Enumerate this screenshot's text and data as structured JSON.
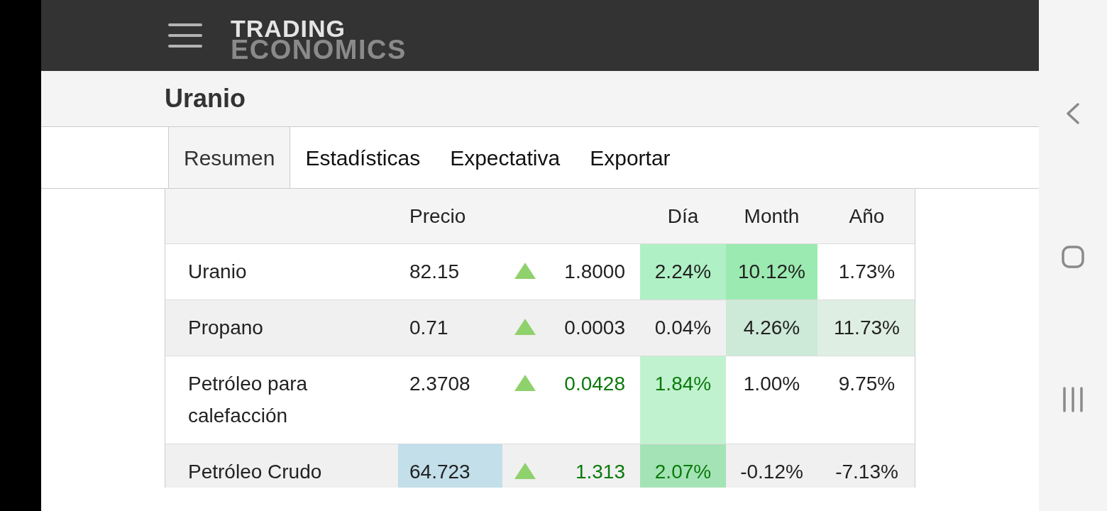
{
  "header": {
    "logo": {
      "line_1": "TRADING",
      "line_2": "ECONOMICS"
    }
  },
  "title": "Uranio",
  "tabs": [
    {
      "label": "Resumen",
      "selected": true
    },
    {
      "label": "Estadísticas",
      "selected": false
    },
    {
      "label": "Expectativa",
      "selected": false
    },
    {
      "label": "Exportar",
      "selected": false
    }
  ],
  "table": {
    "header": {
      "price": "Precio",
      "day": "Día",
      "month": "Month",
      "year": "Año"
    },
    "rows": [
      {
        "column_1": "Uranio",
        "price": {
          "text": "82.15"
        },
        "column_3": {
          "kind": "up"
        },
        "column_4": {
          "text": "1.8000"
        },
        "day": {
          "text": "2.24%",
          "color": "#b0f0c5"
        },
        "month": {
          "text": "10.12%",
          "color": "#9beab1"
        },
        "year": {
          "text": "1.73%"
        }
      },
      {
        "column_1": "Propano",
        "price": {
          "text": "0.71"
        },
        "column_3": {
          "kind": "up"
        },
        "column_4": {
          "text": "0.0003"
        },
        "day": {
          "text": "0.04%"
        },
        "month": {
          "text": "4.26%",
          "color": "#cde9d7"
        },
        "year": {
          "text": "11.73%",
          "color": "#dfeee3"
        }
      },
      {
        "column_1": "Petróleo para calefacción",
        "price": {
          "text": "2.3708"
        },
        "column_3": {
          "kind": "up"
        },
        "column_4": {
          "text": "0.0428",
          "kind": "gain"
        },
        "day": {
          "text": "1.84%",
          "color": "#c1f2d0",
          "kind": "gain"
        },
        "month": {
          "text": "1.00%"
        },
        "year": {
          "text": "9.75%"
        }
      },
      {
        "column_1": "Petróleo Crudo",
        "price": {
          "text": "64.723",
          "color": "#c2dfea"
        },
        "column_3": {
          "kind": "up"
        },
        "column_4": {
          "text": "1.313",
          "kind": "gain"
        },
        "day": {
          "text": "2.07%",
          "color": "#a4e3b6",
          "kind": "gain"
        },
        "month": {
          "text": "-0.12%"
        },
        "year": {
          "text": "-7.13%"
        }
      }
    ]
  }
}
